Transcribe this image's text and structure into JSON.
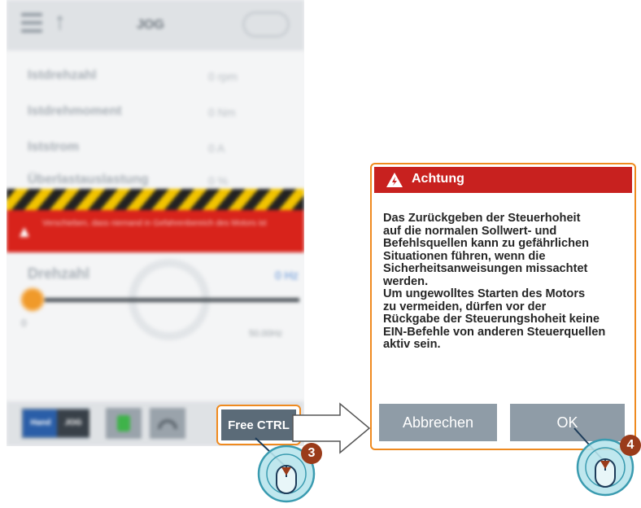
{
  "app": {
    "screen_title": "JOG",
    "params": [
      {
        "label": "Istdrehzahl",
        "value": "0 rpm"
      },
      {
        "label": "Istdrehmoment",
        "value": "0 Nm"
      },
      {
        "label": "Iststrom",
        "value": "0 A"
      },
      {
        "label": "Überlastauslastung",
        "value": "0 %"
      }
    ],
    "warning_banner": "Verschieben, dass niemand in Gefahrenbereich des Motors ist",
    "setpoint_label": "Drehzahl",
    "setpoint_value": "0 Hz",
    "slider": {
      "level": 0,
      "min_label": "0",
      "max_label": "50.00Hz"
    },
    "footer": {
      "mode_a": "Hand",
      "mode_b": "JOG"
    }
  },
  "free_ctrl": {
    "label": "Free CTRL"
  },
  "dialog": {
    "title": "Achtung",
    "body": "    Das Zurückgeben der Steuerhoheit\nauf die normalen Sollwert- und\nBefehlsquellen kann zu gefährlichen\nSituationen führen, wenn die\nSicherheitsanweisungen missachtet\nwerden.\n    Um ungewolltes Starten des Motors\nzu vermeiden, dürfen vor der\nRückgabe der Steuerungshoheit keine\nEIN-Befehle von anderen Steuerquellen\naktiv sein.",
    "cancel_label": "Abbrechen",
    "ok_label": "OK"
  },
  "steps": {
    "step1": "3",
    "step2": "4"
  },
  "colors": {
    "accent_orange": "#ef8a1f",
    "alert_red": "#c8211f",
    "button_gray": "#8f9ca7",
    "badge": "#9a3b1a"
  }
}
